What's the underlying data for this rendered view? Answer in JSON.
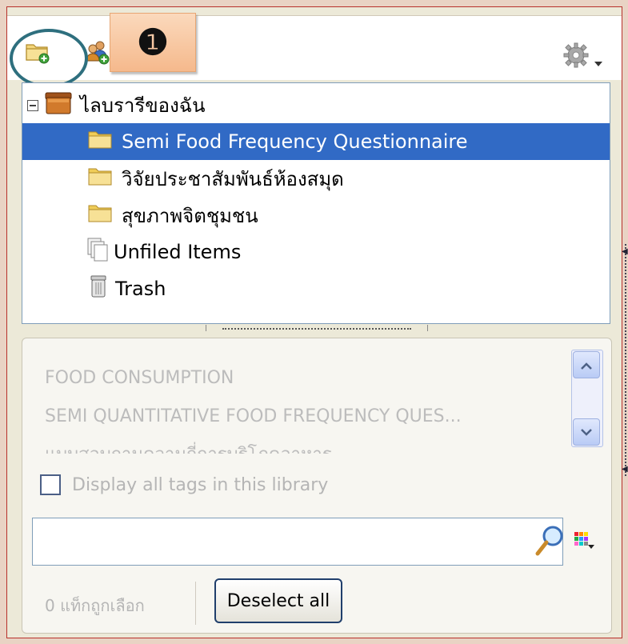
{
  "toolbar": {
    "callout_number": "❶",
    "new_collection_icon": "folder-add-icon",
    "new_group_icon": "group-add-icon",
    "actions_icon": "gear-icon",
    "ring_color": "#2e6f7e"
  },
  "collections": {
    "library_label": "ไลบรารีของฉัน",
    "items": [
      {
        "label": "Semi Food Frequency Questionnaire",
        "icon": "folder-icon",
        "selected": true
      },
      {
        "label": "วิจัยประชาสัมพันธ์ห้องสมุด",
        "icon": "folder-icon",
        "selected": false
      },
      {
        "label": "สุขภาพจิตชุมชน",
        "icon": "folder-icon",
        "selected": false
      },
      {
        "label": "Unfiled Items",
        "icon": "unfiled-items-icon",
        "selected": false
      },
      {
        "label": "Trash",
        "icon": "trash-icon",
        "selected": false
      }
    ],
    "selection_color": "#316ac5"
  },
  "tags": {
    "items": [
      "FOOD CONSUMPTION",
      "SEMI QUANTITATIVE FOOD FREQUENCY QUES...",
      "แบบสอบถามความถี่การบริโภคอาหาร"
    ],
    "display_all_label": "Display all tags in this library",
    "display_all_checked": false,
    "filter_value": "",
    "selected_count_label": "0 แท็กถูกเลือก",
    "deselect_all_label": "Deselect all"
  }
}
